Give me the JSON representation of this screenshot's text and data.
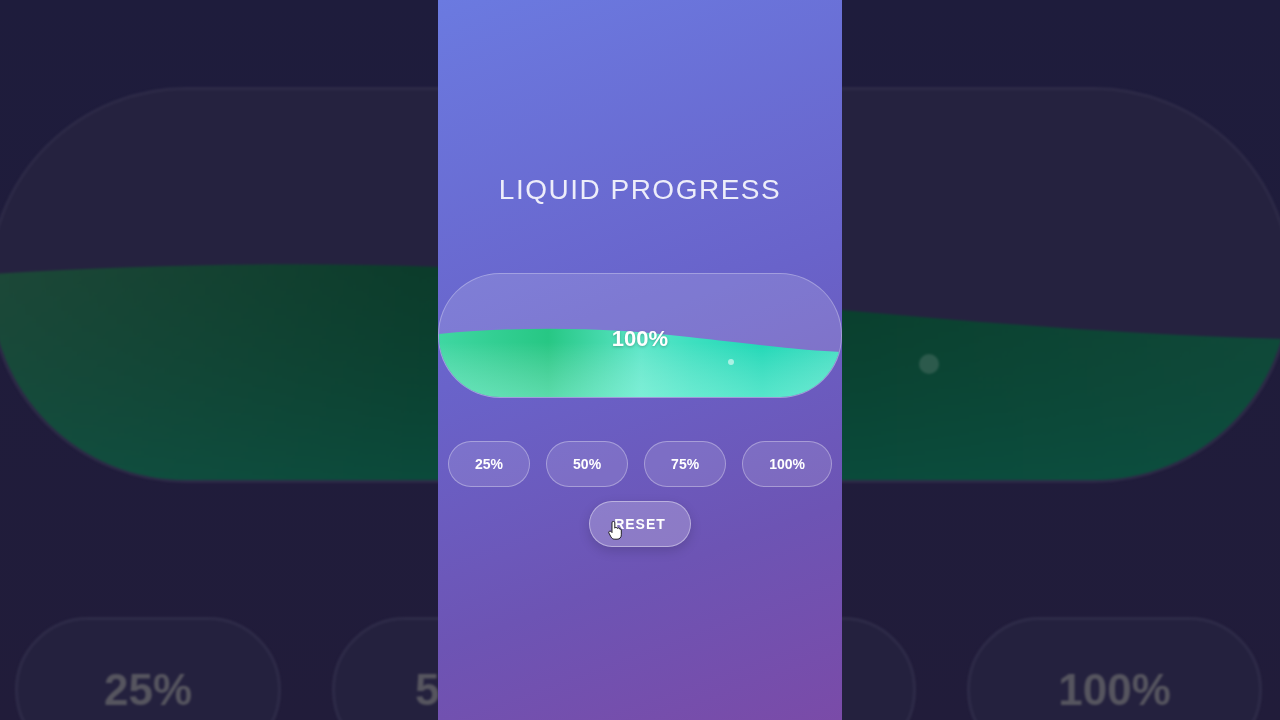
{
  "backdrop": {
    "level": 1,
    "left_buttons": [
      "25%",
      "5"
    ],
    "right_buttons": [
      "100%"
    ]
  },
  "title": "LIQUID PROGRESS",
  "progress": {
    "level": 1,
    "reading": "100%"
  },
  "presets": [
    "25%",
    "50%",
    "75%",
    "100%"
  ],
  "reset_button": {
    "label": "RESET"
  }
}
